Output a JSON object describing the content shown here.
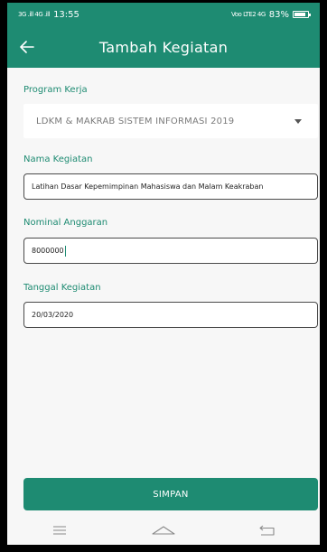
{
  "status_bar": {
    "signal_left": "3G .ill 4G .ill",
    "time": "13:55",
    "network_right": "Voo LTE2 4G",
    "battery": "83%",
    "battery_level": 0.83
  },
  "app_bar": {
    "back_icon": "arrow-left-icon",
    "title": "Tambah Kegiatan"
  },
  "form": {
    "program_kerja": {
      "label": "Program Kerja",
      "value": "LDKM & MAKRAB SISTEM INFORMASI 2019"
    },
    "nama_kegiatan": {
      "label": "Nama Kegiatan",
      "value": "Latihan Dasar Kepemimpinan Mahasiswa dan Malam Keakraban"
    },
    "nominal_anggaran": {
      "label": "Nominal Anggaran",
      "value": "8000000"
    },
    "tanggal_kegiatan": {
      "label": "Tanggal Kegiatan",
      "value": "20/03/2020"
    }
  },
  "actions": {
    "save_label": "SIMPAN"
  },
  "colors": {
    "primary": "#1e8b72",
    "background": "#f7f7f7"
  },
  "nav_bar": {
    "menu_icon": "menu-icon",
    "home_icon": "home-icon",
    "back_icon": "back-icon"
  }
}
